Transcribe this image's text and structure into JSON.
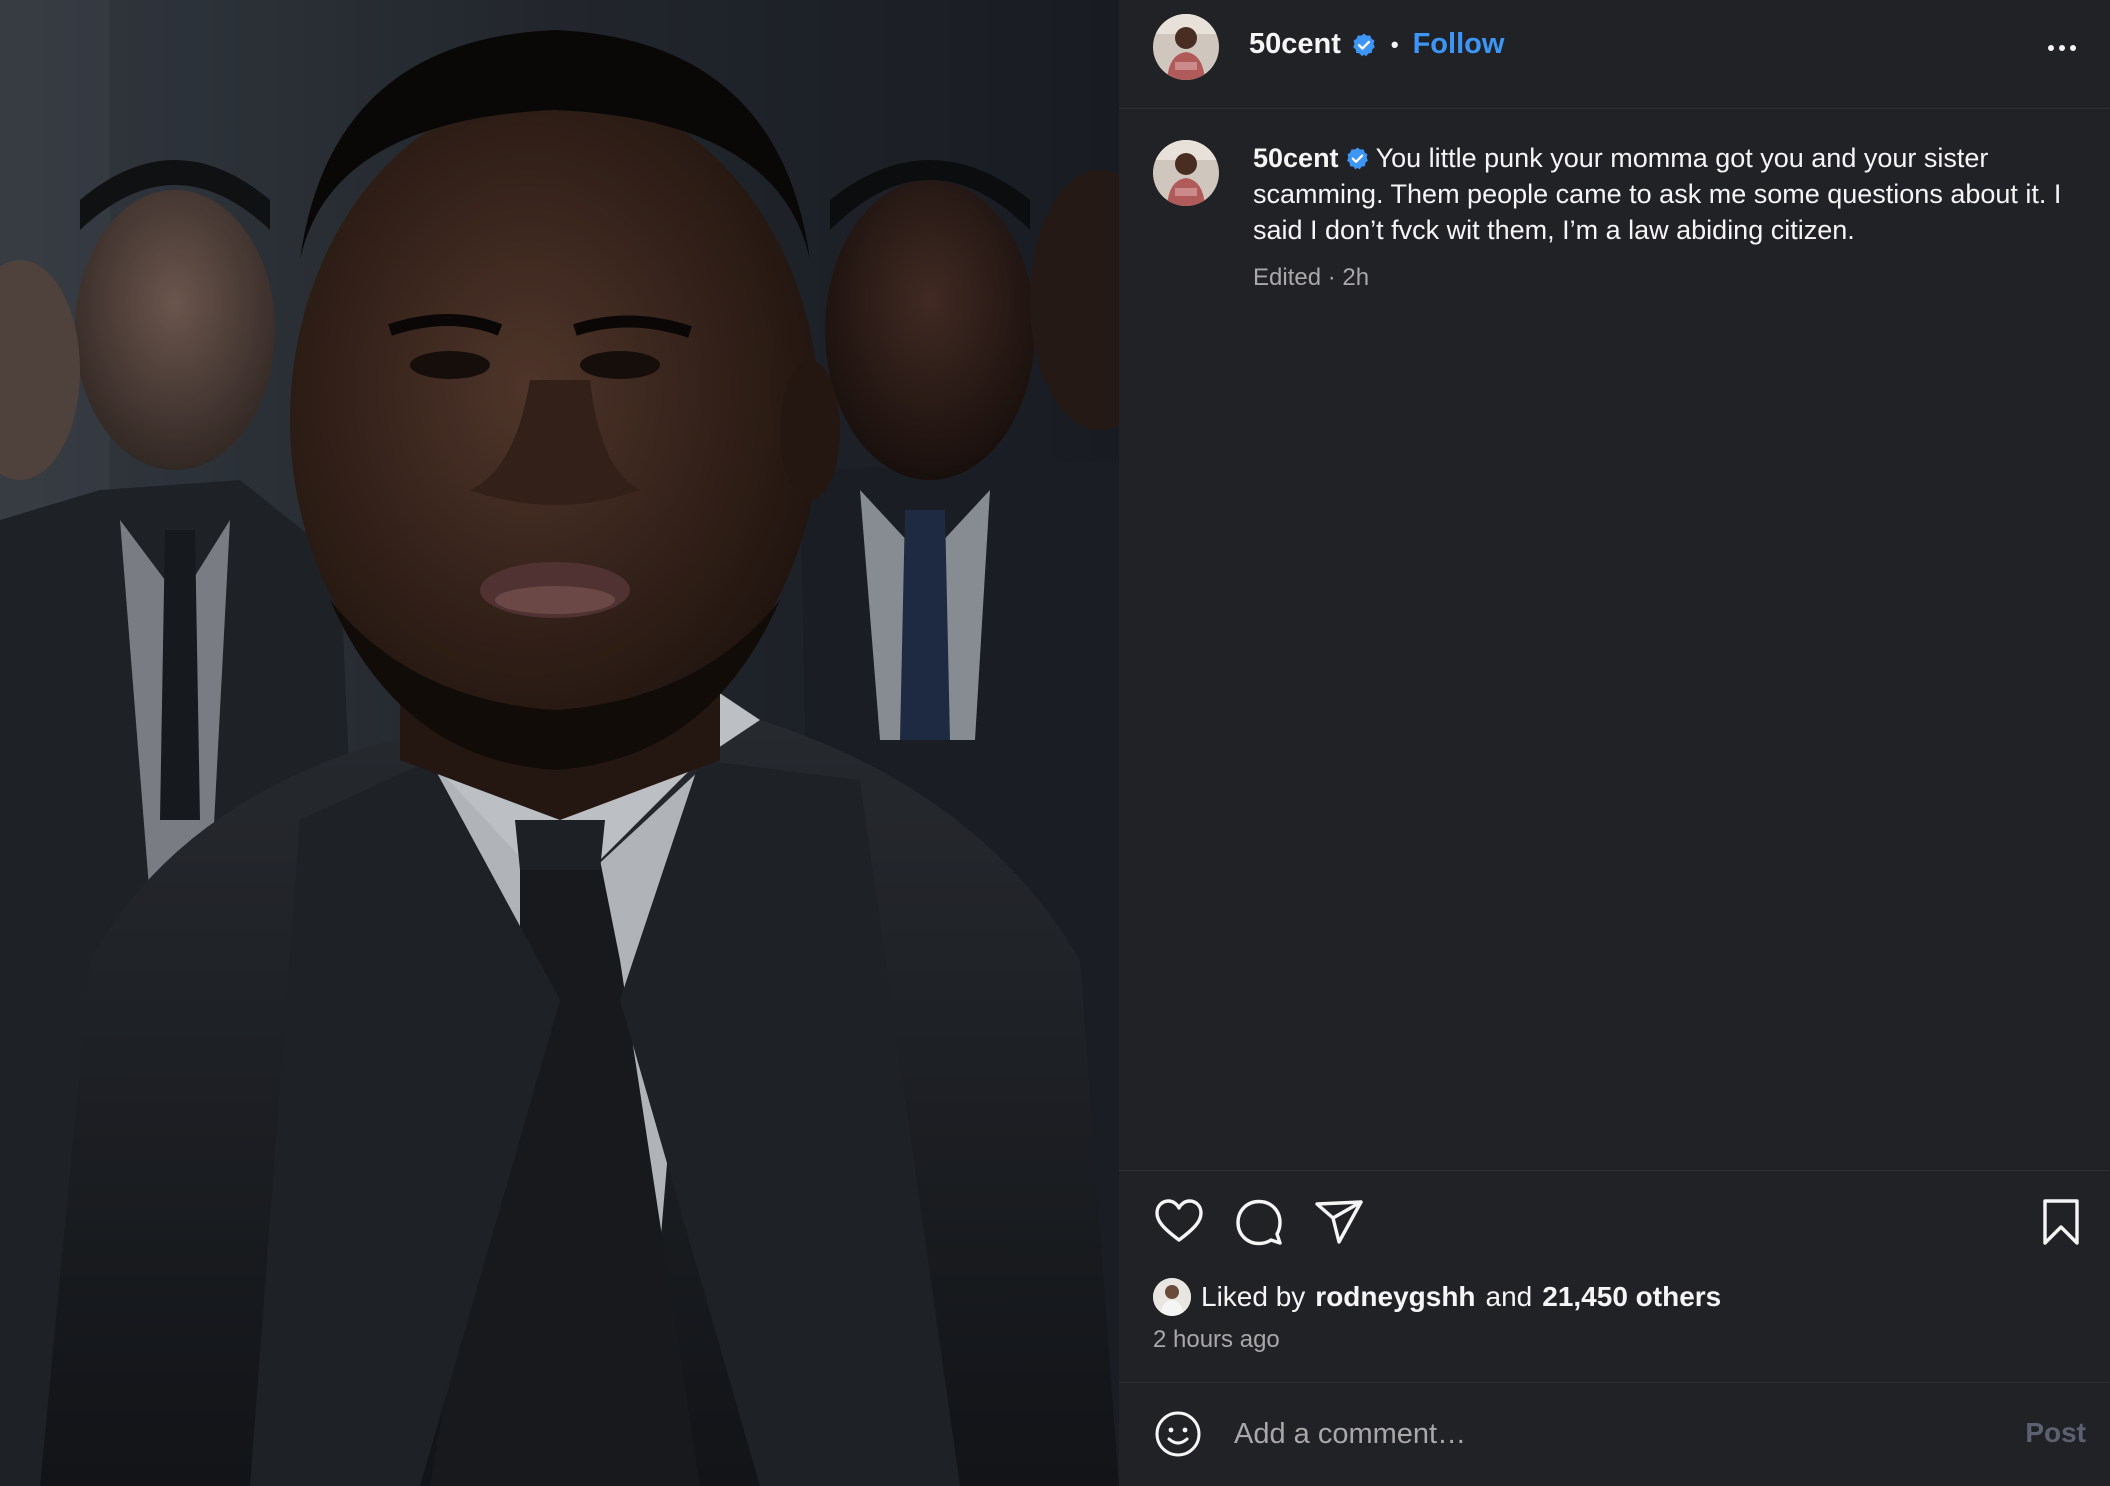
{
  "post": {
    "username": "50cent",
    "separator": "•",
    "follow_label": "Follow",
    "caption_text": "You little punk your momma got you and your sister scamming. Them people came to ask me some questions about it. I said I don’t fvck wit them, I’m a law abiding citizen.",
    "caption_meta": "Edited · 2h",
    "likes": {
      "prefix": "Liked by",
      "liker": "rodneygshh",
      "conjunction": "and",
      "others": "21,450 others"
    },
    "time_ago": "2 hours ago"
  },
  "comment": {
    "placeholder": "Add a comment…",
    "post_label": "Post"
  },
  "icons": {
    "verified": "verified-badge-icon",
    "more": "more-options-icon",
    "like": "heart-icon",
    "comment": "comment-icon",
    "share": "send-icon",
    "save": "bookmark-icon",
    "emoji": "emoji-icon"
  },
  "colors": {
    "background": "#212226",
    "accent_blue": "#3d95f5",
    "muted_text": "#a8a8a8",
    "post_disabled": "#5a6170"
  }
}
